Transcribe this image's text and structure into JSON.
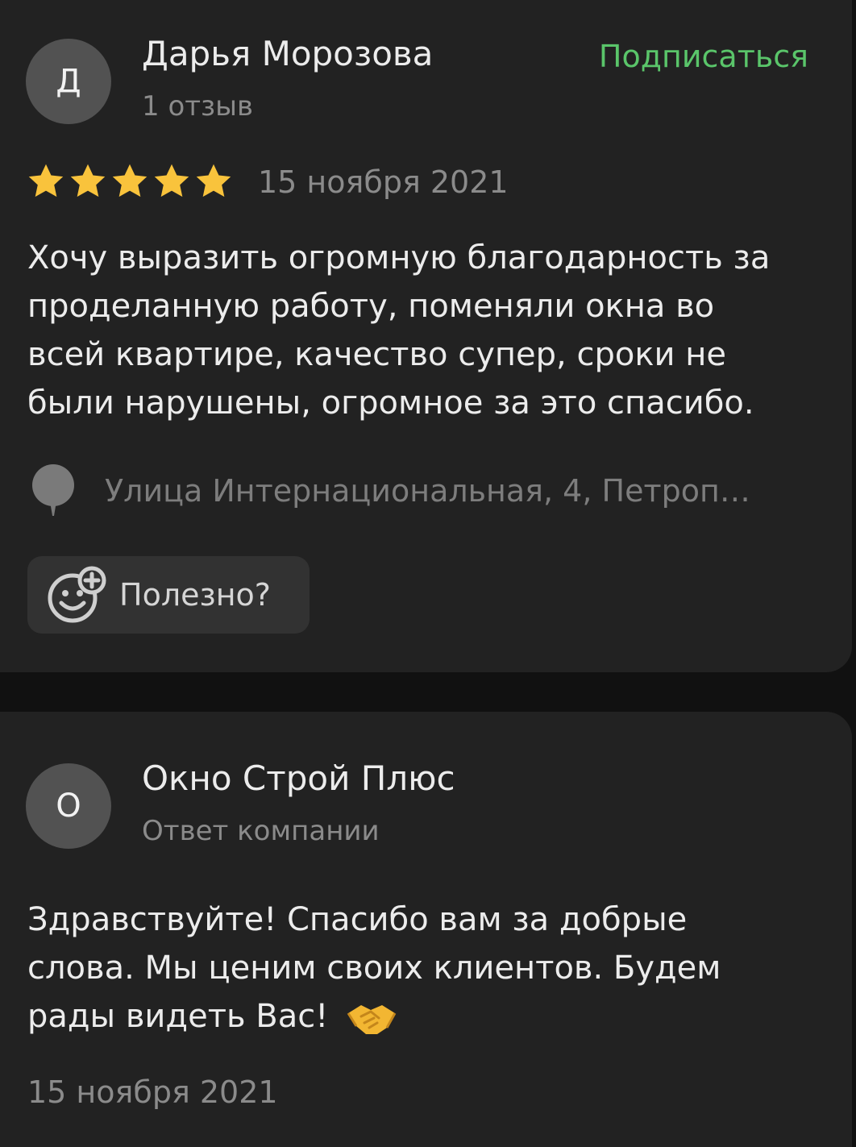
{
  "review": {
    "avatar_letter": "Д",
    "author": "Дарья Морозова",
    "reviews_count": "1 отзыв",
    "subscribe_label": "Подписаться",
    "rating": 5,
    "rating_max": 5,
    "date": "15 ноября 2021",
    "text": "Хочу выразить огромную благодарность за проделанную работу, поменяли окна во всей квартире, качество супер, сроки не были нарушены, огромное за это спасибо.",
    "address": "Улица Интернациональная, 4, Петроп…",
    "useful_label": "Полезно?",
    "colors": {
      "star": "#f9c33c",
      "accent": "#5ac56a"
    }
  },
  "reply": {
    "avatar_letter": "О",
    "company": "Окно Строй Плюс",
    "subtitle": "Ответ компании",
    "text": "Здравствуйте! Спасибо вам за добрые слова. Мы ценим своих клиентов. Будем рады видеть Вас!",
    "emoji_icon": "handshake-icon",
    "date": "15 ноября 2021"
  }
}
